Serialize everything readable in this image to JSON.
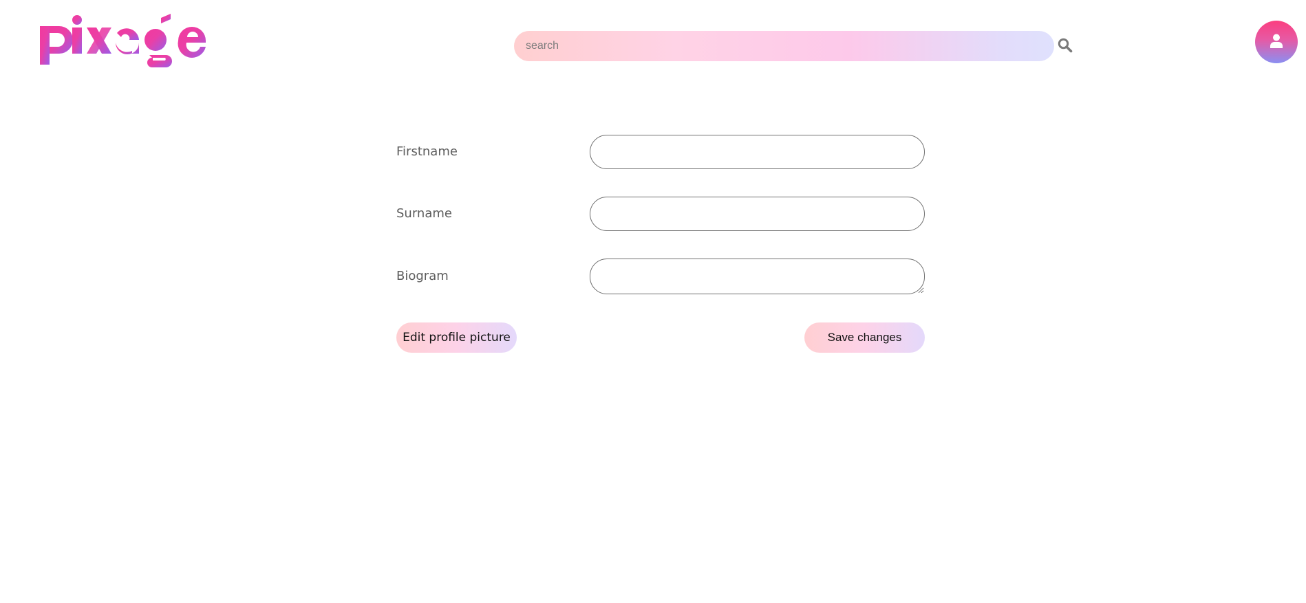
{
  "header": {
    "logo_text": "pixage",
    "search": {
      "placeholder": "search",
      "value": ""
    },
    "search_icon": "magnifier-icon",
    "avatar_icon": "user-icon"
  },
  "form": {
    "firstname": {
      "label": "Firstname",
      "value": ""
    },
    "surname": {
      "label": "Surname",
      "value": ""
    },
    "biogram": {
      "label": "Biogram",
      "value": ""
    },
    "edit_picture_label": "Edit profile picture",
    "save_label": "Save changes"
  },
  "colors": {
    "brand_pink": "#f0399a",
    "brand_purple": "#9b5ce8",
    "search_gradient_start": "#ffcfd0",
    "search_gradient_end": "#dfe1fd",
    "avatar_top": "#fb3f7f",
    "avatar_bottom": "#8a8ff2",
    "label_text": "#5d5d5d",
    "field_border": "#6f6f6f"
  }
}
